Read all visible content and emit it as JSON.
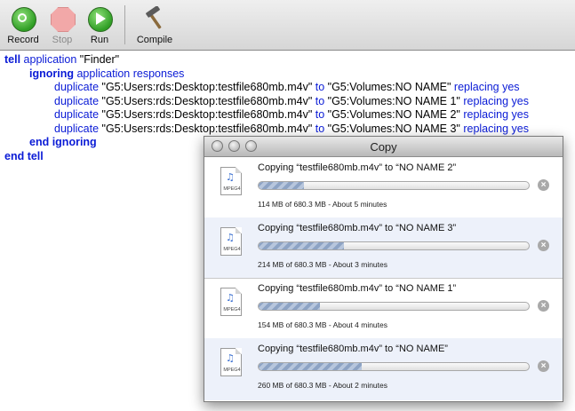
{
  "toolbar": {
    "record_label": "Record",
    "stop_label": "Stop",
    "run_label": "Run",
    "compile_label": "Compile"
  },
  "script": {
    "l1": {
      "kw": "tell",
      "app": "application",
      "str": " \"Finder\""
    },
    "l2": {
      "kw": "ignoring",
      "app": "application responses"
    },
    "l3": {
      "cmd": "duplicate",
      "src": " \"G5:Users:rds:Desktop:testfile680mb.m4v\" ",
      "to": "to",
      "dst": " \"G5:Volumes:NO NAME\" ",
      "opt": "replacing yes"
    },
    "l4": {
      "cmd": "duplicate",
      "src": " \"G5:Users:rds:Desktop:testfile680mb.m4v\" ",
      "to": "to",
      "dst": " \"G5:Volumes:NO NAME 1\" ",
      "opt": "replacing yes"
    },
    "l5": {
      "cmd": "duplicate",
      "src": " \"G5:Users:rds:Desktop:testfile680mb.m4v\" ",
      "to": "to",
      "dst": " \"G5:Volumes:NO NAME 2\" ",
      "opt": "replacing yes"
    },
    "l6": {
      "cmd": "duplicate",
      "src": " \"G5:Users:rds:Desktop:testfile680mb.m4v\" ",
      "to": "to",
      "dst": " \"G5:Volumes:NO NAME 3\" ",
      "opt": "replacing yes"
    },
    "l7": {
      "kw": "end ignoring"
    },
    "l8": {
      "kw": "end tell"
    }
  },
  "copy_window": {
    "title": "Copy",
    "file_type_label": "MPEG4",
    "jobs": [
      {
        "title": "Copying “testfile680mb.m4v” to “NO NAME 2”",
        "status": "114 MB of 680.3 MB - About 5 minutes",
        "progress": 0.168
      },
      {
        "title": "Copying “testfile680mb.m4v” to “NO NAME 3”",
        "status": "214 MB of 680.3 MB - About 3 minutes",
        "progress": 0.315
      },
      {
        "title": "Copying “testfile680mb.m4v” to “NO NAME 1”",
        "status": "154 MB of 680.3 MB - About 4 minutes",
        "progress": 0.226
      },
      {
        "title": "Copying “testfile680mb.m4v” to “NO NAME”",
        "status": "260 MB of 680.3 MB - About 2 minutes",
        "progress": 0.382
      }
    ]
  },
  "colors": {
    "keyword": "#0a1bd6",
    "progress": "#8da3c4"
  }
}
